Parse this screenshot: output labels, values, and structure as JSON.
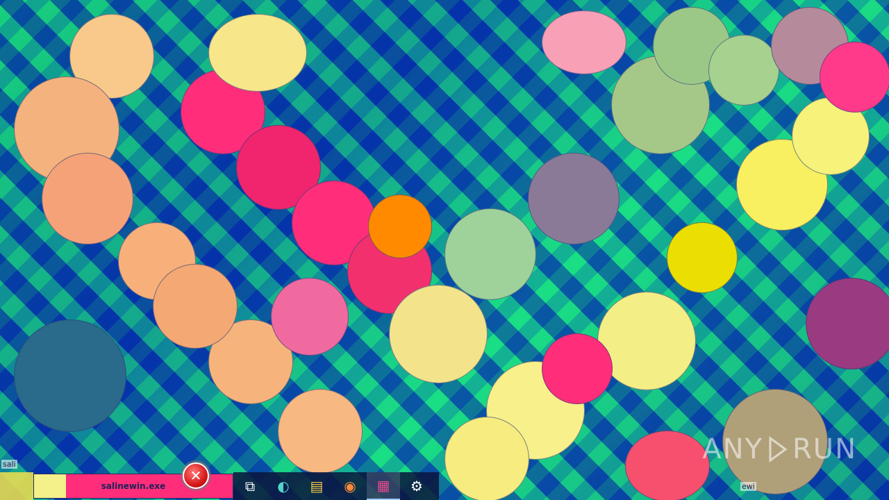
{
  "taskbar": {
    "active_window_label": "salinewin.exe",
    "icons": [
      {
        "name": "task-view-icon",
        "glyph": "⧉"
      },
      {
        "name": "edge-icon",
        "glyph": "◐"
      },
      {
        "name": "file-explorer-icon",
        "glyph": "▤"
      },
      {
        "name": "firefox-icon",
        "glyph": "◉"
      },
      {
        "name": "winrar-icon",
        "glyph": "▦"
      },
      {
        "name": "settings-icon",
        "glyph": "⚙"
      }
    ]
  },
  "error_badge": {
    "symbol": "✕"
  },
  "watermark": {
    "text_left": "ANY",
    "text_right": "RUN"
  },
  "desktop_fragments": {
    "left_label": "sali",
    "right_label": "ewi"
  },
  "colors": {
    "error_red": "#d81818",
    "taskbar_dark": "#0a143c",
    "glitch_pink": "#ff2d7a",
    "glitch_yellow": "#f4f08a",
    "glitch_green": "#1ed27a",
    "glitch_blue": "#0a3aa8"
  }
}
